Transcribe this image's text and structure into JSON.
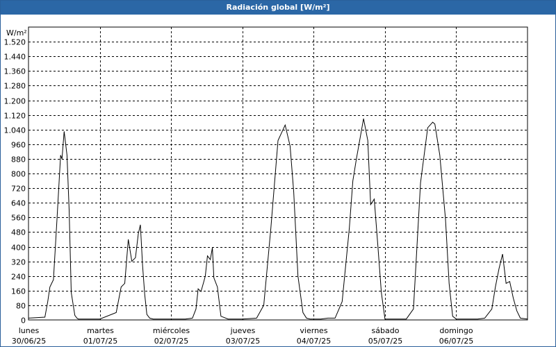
{
  "chart_data": {
    "type": "line",
    "title": "Radiación global [W/m²]",
    "unit_label": "W/m²",
    "ylim": [
      0,
      1600
    ],
    "yticks": [
      "1.520",
      "1.440",
      "1.360",
      "1.280",
      "1.200",
      "1.120",
      "1.040",
      "960",
      "880",
      "800",
      "720",
      "640",
      "560",
      "480",
      "400",
      "320",
      "240",
      "160",
      "80",
      "0"
    ],
    "ytick_values": [
      1520,
      1440,
      1360,
      1280,
      1200,
      1120,
      1040,
      960,
      880,
      800,
      720,
      640,
      560,
      480,
      400,
      320,
      240,
      160,
      80,
      0
    ],
    "xlim": [
      0,
      7
    ],
    "xticks": [
      {
        "day": "lunes",
        "date": "30/06/25"
      },
      {
        "day": "martes",
        "date": "01/07/25"
      },
      {
        "day": "miércoles",
        "date": "02/07/25"
      },
      {
        "day": "jueves",
        "date": "03/07/25"
      },
      {
        "day": "viernes",
        "date": "04/07/25"
      },
      {
        "day": "sábado",
        "date": "05/07/25"
      },
      {
        "day": "domingo",
        "date": "06/07/25"
      }
    ],
    "grid": true,
    "series": [
      {
        "color": "#000000",
        "x": [
          0,
          0.23,
          0.27,
          0.3,
          0.35,
          0.4,
          0.45,
          0.47,
          0.5,
          0.54,
          0.57,
          0.6,
          0.65,
          0.68,
          0.7,
          0.75,
          0.8,
          1,
          1.23,
          1.3,
          1.35,
          1.4,
          1.45,
          1.5,
          1.54,
          1.57,
          1.6,
          1.63,
          1.66,
          1.7,
          1.75,
          1.8,
          2,
          2.1,
          2.2,
          2.3,
          2.35,
          2.38,
          2.42,
          2.46,
          2.48,
          2.51,
          2.55,
          2.58,
          2.6,
          2.65,
          2.7,
          2.8,
          3,
          3.2,
          3.3,
          3.4,
          3.5,
          3.6,
          3.67,
          3.72,
          3.78,
          3.85,
          3.9,
          3.95,
          4,
          4.1,
          4.2,
          4.3,
          4.4,
          4.5,
          4.55,
          4.6,
          4.7,
          4.76,
          4.8,
          4.85,
          4.9,
          4.95,
          5.0,
          5.1,
          5.2,
          5.3,
          5.4,
          5.5,
          5.6,
          5.67,
          5.7,
          5.77,
          5.85,
          5.9,
          5.95,
          6.0,
          6.1,
          6.2,
          6.3,
          6.4,
          6.5,
          6.55,
          6.6,
          6.65,
          6.7,
          6.75,
          6.8,
          6.85,
          6.9,
          7
        ],
        "y": [
          10,
          15,
          100,
          180,
          220,
          550,
          900,
          880,
          1030,
          900,
          600,
          150,
          25,
          10,
          5,
          5,
          5,
          5,
          40,
          180,
          200,
          440,
          320,
          340,
          470,
          520,
          300,
          140,
          30,
          10,
          5,
          5,
          5,
          5,
          5,
          10,
          60,
          170,
          155,
          210,
          240,
          350,
          330,
          395,
          230,
          180,
          20,
          5,
          5,
          10,
          80,
          500,
          980,
          1065,
          950,
          700,
          240,
          40,
          10,
          5,
          5,
          5,
          10,
          10,
          100,
          500,
          760,
          880,
          1100,
          980,
          630,
          660,
          410,
          150,
          5,
          5,
          5,
          5,
          60,
          750,
          1050,
          1080,
          1070,
          900,
          550,
          200,
          20,
          5,
          5,
          5,
          5,
          10,
          60,
          180,
          280,
          360,
          200,
          210,
          120,
          50,
          10,
          5
        ]
      }
    ]
  }
}
